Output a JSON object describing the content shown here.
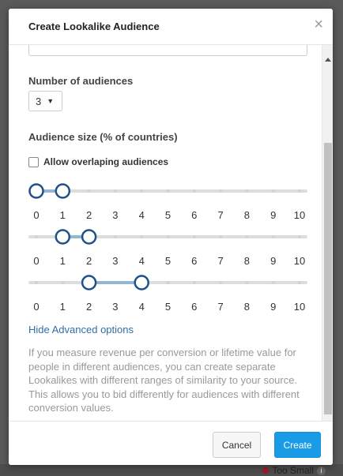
{
  "background": {
    "badge_text": "Too Small",
    "badge_dot_color": "#a0182c"
  },
  "modal": {
    "title": "Create Lookalike Audience",
    "close_symbol": "×"
  },
  "number_of_audiences": {
    "label": "Number of audiences",
    "selected": "3",
    "arrow": "▼"
  },
  "audience_size": {
    "label": "Audience size (% of countries)",
    "overlap_checkbox_label": "Allow overlaping audiences",
    "overlap_checked": false,
    "ticks": [
      "0",
      "1",
      "2",
      "3",
      "4",
      "5",
      "6",
      "7",
      "8",
      "9",
      "10"
    ],
    "ranges": [
      {
        "min": 0,
        "max": 1
      },
      {
        "min": 1,
        "max": 2
      },
      {
        "min": 2,
        "max": 4
      }
    ]
  },
  "advanced_link": "Hide Advanced options",
  "help_text": "If you measure revenue per conversion or lifetime value for people in different audiences, you can create separate Lookalikes with different ranges of similarity to your source. This allows you to bid differently for audiences with different conversion values.",
  "footer": {
    "cancel_label": "Cancel",
    "create_label": "Create"
  },
  "colors": {
    "accent": "#1a9be6",
    "link": "#2f6ea8",
    "slider_handle": "#1f5288",
    "slider_range": "#93b6d2",
    "slider_track": "#dddddd"
  }
}
